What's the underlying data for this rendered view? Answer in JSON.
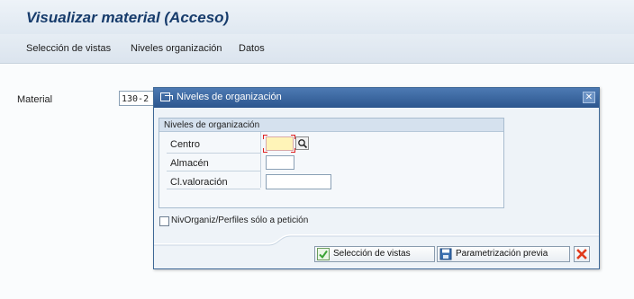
{
  "window": {
    "title": "Visualizar material (Acceso)"
  },
  "menu": [
    {
      "label": "Selección de vistas"
    },
    {
      "label": "Niveles organización"
    },
    {
      "label": "Datos"
    }
  ],
  "main": {
    "material_label": "Material",
    "material_value": "130-2"
  },
  "dialog": {
    "title": "Niveles de organización",
    "group_title": "Niveles de organización",
    "fields": [
      {
        "label": "Centro",
        "value": "",
        "required": true
      },
      {
        "label": "Almacén",
        "value": ""
      },
      {
        "label": "Cl.valoración",
        "value": ""
      }
    ],
    "checkbox_label": "NivOrganiz/Perfiles sólo a petición",
    "checkbox_checked": false,
    "buttons": {
      "select_views": "Selección de vistas",
      "preset": "Parametrización previa"
    },
    "icons": {
      "close": "close-icon",
      "confirm": "checkmark-icon",
      "save": "save-icon",
      "cancel": "cancel-icon",
      "search": "search-icon"
    }
  },
  "colors": {
    "header_text": "#173c6c",
    "dialog_header": "#2c568e",
    "required_field": "#fff4b8",
    "confirm_green": "#3aa335",
    "cancel_red": "#e03a1c"
  }
}
